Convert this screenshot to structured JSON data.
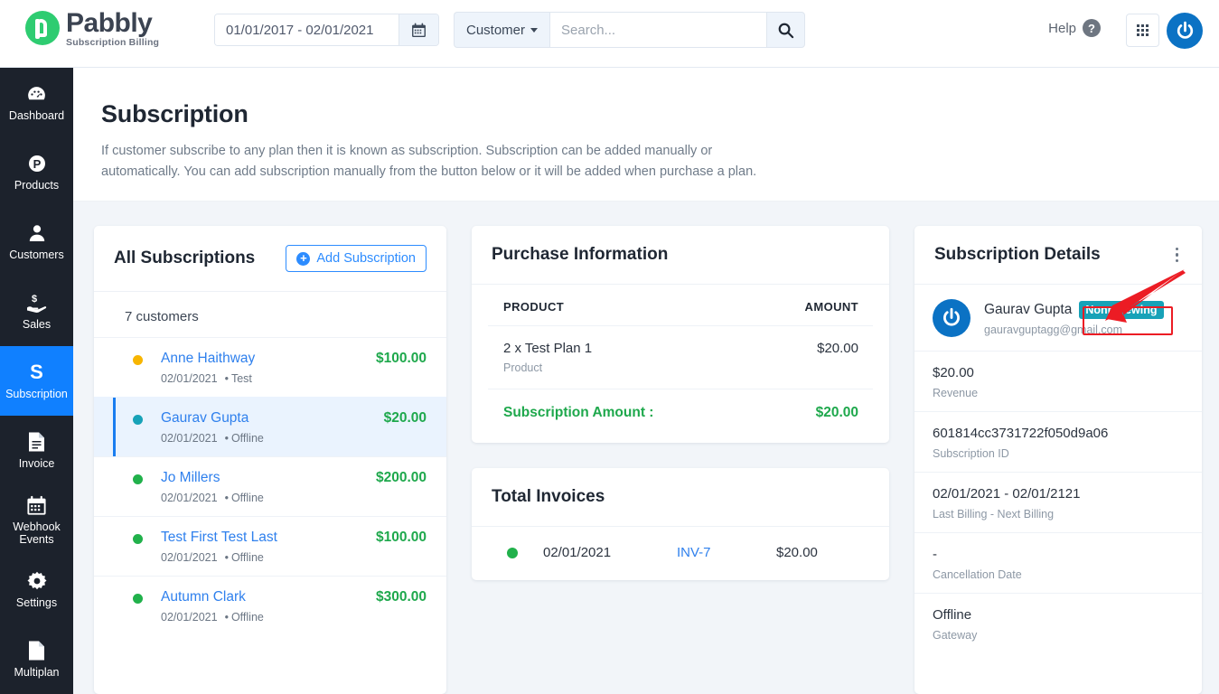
{
  "brand": {
    "name": "Pabbly",
    "tagline": "Subscription Billing"
  },
  "topbar": {
    "date_range": "01/01/2017 - 02/01/2021",
    "calendar_icon": "calendar-icon",
    "search_scope": "Customer",
    "search_placeholder": "Search...",
    "search_icon": "search-icon",
    "help_label": "Help",
    "help_icon": "question-circle-icon",
    "apps_icon": "grid-apps-icon",
    "user_icon": "power-user-icon"
  },
  "sidebar": {
    "items": [
      {
        "label": "Dashboard",
        "icon": "speedometer-icon",
        "active": false
      },
      {
        "label": "Products",
        "icon": "product-p-icon",
        "active": false
      },
      {
        "label": "Customers",
        "icon": "user-icon",
        "active": false
      },
      {
        "label": "Sales",
        "icon": "hand-money-icon",
        "active": false
      },
      {
        "label": "Subscription",
        "icon": "subscription-s-icon",
        "active": true
      },
      {
        "label": "Invoice",
        "icon": "document-lines-icon",
        "active": false
      },
      {
        "label": "Webhook Events",
        "icon": "calendar-icon",
        "active": false
      },
      {
        "label": "Settings",
        "icon": "gear-icon",
        "active": false
      },
      {
        "label": "Multiplan",
        "icon": "file-icon",
        "active": false
      }
    ]
  },
  "page": {
    "title": "Subscription",
    "description": "If customer subscribe to any plan then it is known as subscription. Subscription can be added manually or automatically. You can add subscription manually from the button below or it will be added when purchase a plan."
  },
  "all_subscriptions": {
    "title": "All Subscriptions",
    "add_button": "Add Subscription",
    "add_icon": "plus-circle-icon",
    "count_text": "7 customers",
    "rows": [
      {
        "name": "Anne Haithway",
        "date": "02/01/2021",
        "gateway": "Test",
        "amount": "$100.00",
        "dot_color": "#f7b500",
        "selected": false
      },
      {
        "name": "Gaurav Gupta",
        "date": "02/01/2021",
        "gateway": "Offline",
        "amount": "$20.00",
        "dot_color": "#17a2b8",
        "selected": true
      },
      {
        "name": "Jo Millers",
        "date": "02/01/2021",
        "gateway": "Offline",
        "amount": "$200.00",
        "dot_color": "#21b14b",
        "selected": false
      },
      {
        "name": "Test First Test Last",
        "date": "02/01/2021",
        "gateway": "Offline",
        "amount": "$100.00",
        "dot_color": "#21b14b",
        "selected": false
      },
      {
        "name": "Autumn Clark",
        "date": "02/01/2021",
        "gateway": "Offline",
        "amount": "$300.00",
        "dot_color": "#21b14b",
        "selected": false
      }
    ]
  },
  "purchase_information": {
    "title": "Purchase Information",
    "col_product": "PRODUCT",
    "col_amount": "AMOUNT",
    "item_name": "2 x Test Plan 1",
    "item_type": "Product",
    "item_amount": "$20.00",
    "total_label": "Subscription Amount :",
    "total_amount": "$20.00"
  },
  "total_invoices": {
    "title": "Total Invoices",
    "row": {
      "date": "02/01/2021",
      "invoice_no": "INV-7",
      "amount": "$20.00",
      "dot_color": "#21b14b"
    }
  },
  "subscription_details": {
    "title": "Subscription Details",
    "menu_icon": "kebab-menu-icon",
    "avatar_icon": "power-user-icon",
    "customer_name": "Gaurav Gupta",
    "status_badge": "Nonrenewing",
    "customer_email": "gauravguptagg@gmail.com",
    "fields": [
      {
        "value": "$20.00",
        "label": "Revenue"
      },
      {
        "value": "601814cc3731722f050d9a06",
        "label": "Subscription ID"
      },
      {
        "value": "02/01/2021 - 02/01/2121",
        "label": "Last Billing - Next Billing"
      },
      {
        "value": "-",
        "label": "Cancellation Date"
      },
      {
        "value": "Offline",
        "label": "Gateway"
      }
    ]
  },
  "annotation": {
    "color": "#ec1c24",
    "target": "status-badge"
  },
  "colors": {
    "accent_blue": "#1080ff",
    "link_blue": "#2f80ed",
    "green": "#1ea84c",
    "teal": "#17a2b8",
    "amber": "#f7b500",
    "sidebar_bg": "#1c222c",
    "content_bg": "#f2f5f9"
  }
}
